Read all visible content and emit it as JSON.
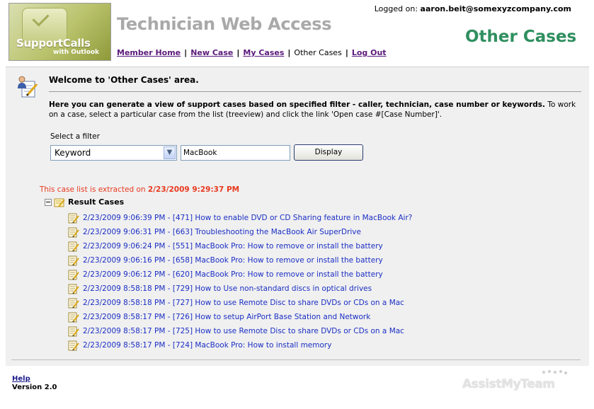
{
  "logo": {
    "line1": "SupportCalls",
    "line2": "with Outlook"
  },
  "app_title": "Technician Web Access",
  "logged": {
    "label": "Logged on:",
    "user": "aaron.beit@somexyzcompany.com"
  },
  "nav": {
    "member_home": "Member Home",
    "new_case": "New Case",
    "my_cases": "My Cases",
    "other_cases": "Other Cases",
    "log_out": "Log Out",
    "separator": "|"
  },
  "page_heading": "Other Cases",
  "welcome": {
    "title": "Welcome to 'Other Cases' area.",
    "desc_bold": "Here you can generate a view of support cases based on specified filter - caller, technician, case number or keywords.",
    "desc_rest": "To work on a case, select a particular case from the list (treeview) and click the link 'Open case #[Case Number]'."
  },
  "filter": {
    "label": "Select a filter",
    "selected": "Keyword",
    "keyword_value": "MacBook",
    "display_label": "Display"
  },
  "extract": {
    "label": "This case list is extracted on",
    "timestamp": "2/23/2009 9:29:37 PM"
  },
  "tree": {
    "root_label": "Result Cases",
    "cases": [
      "2/23/2009 9:06:39 PM - [471] How to enable DVD or CD Sharing feature in MacBook Air?",
      "2/23/2009 9:06:31 PM - [663] Troubleshooting the MacBook Air SuperDrive",
      "2/23/2009 9:06:24 PM - [551] MacBook Pro: How to remove or install the battery",
      "2/23/2009 9:06:16 PM - [658] MacBook Pro: How to remove or install the battery",
      "2/23/2009 9:06:12 PM - [620] MacBook Pro: How to remove or install the battery",
      "2/23/2009 8:58:18 PM - [729] How to Use non-standard discs in optical drives",
      "2/23/2009 8:58:18 PM - [727] How to use Remote Disc to share DVDs or CDs on a Mac",
      "2/23/2009 8:58:17 PM - [726] How to setup AirPort Base Station and Network",
      "2/23/2009 8:58:17 PM - [725] How to use Remote Disc to share DVDs or CDs on a Mac",
      "2/23/2009 8:58:17 PM - [724] MacBook Pro: How to install memory"
    ]
  },
  "footer": {
    "help": "Help",
    "version": "Version 2.0",
    "brand": "AssistMyTeam"
  },
  "colors": {
    "heading": "#2f8f5f",
    "link": "#1a2ec4",
    "nav_link": "#5b1a7a",
    "extract_note": "#e8391e",
    "content_bg": "#f0f0f0"
  },
  "icons": {
    "welcome": "user-edit-icon",
    "root": "folder-note-icon",
    "case": "note-pencil-icon"
  }
}
